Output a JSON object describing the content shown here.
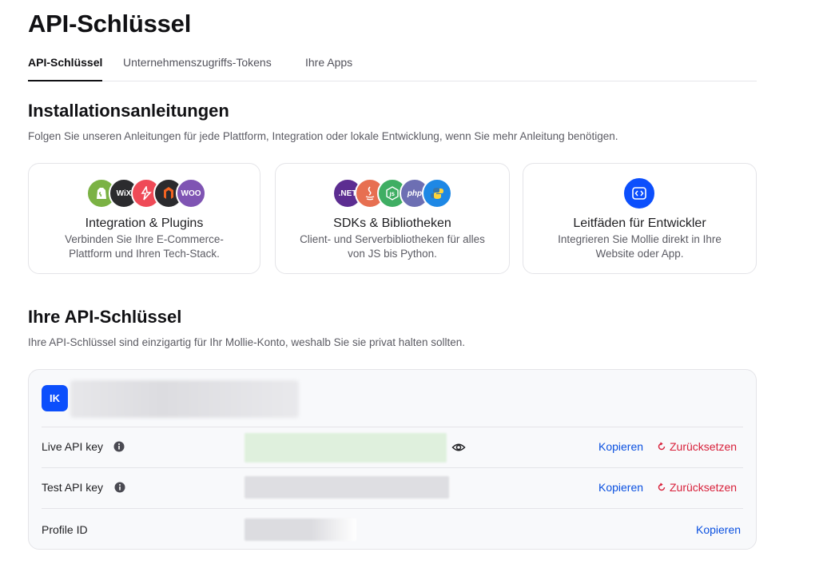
{
  "header": {
    "title": "API-Schlüssel"
  },
  "tabs": [
    {
      "label": "API-Schlüssel",
      "active": true
    },
    {
      "label": "Unternehmenszugriffs-Tokens",
      "active": false
    },
    {
      "label": "Ihre Apps",
      "active": false
    }
  ],
  "installation": {
    "title": "Installationsanleitungen",
    "description": "Folgen Sie unseren Anleitungen für jede Plattform, Integration oder lokale Entwicklung, wenn Sie mehr Anleitung benötigen.",
    "cards": [
      {
        "title": "Integration & Plugins",
        "description": "Verbinden Sie Ihre E-Commerce-Plattform und Ihren Tech-Stack.",
        "icons": [
          "shopify-icon",
          "wix-icon",
          "lightspeed-icon",
          "magento-icon",
          "woocommerce-icon"
        ]
      },
      {
        "title": "SDKs & Bibliotheken",
        "description": "Client- und Serverbibliotheken für alles von JS bis Python.",
        "icons": [
          "dotnet-icon",
          "java-icon",
          "nodejs-icon",
          "php-icon",
          "python-icon"
        ]
      },
      {
        "title": "Leitfäden für Entwickler",
        "description": "Integrieren Sie Mollie direkt in Ihre Website oder App.",
        "icons": [
          "code-guide-icon"
        ]
      }
    ]
  },
  "logo_text": {
    "wix": "WiX",
    "dotnet": ".NET",
    "php": "php",
    "woo": "WOO"
  },
  "api_keys": {
    "title": "Ihre API-Schlüssel",
    "description": "Ihre API-Schlüssel sind einzigartig für Ihr Mollie-Konto, weshalb Sie sie privat halten sollten.",
    "profile_initials": "IK",
    "rows": [
      {
        "label": "Live API key",
        "copy": "Kopieren",
        "reset": "Zurücksetzen"
      },
      {
        "label": "Test API key",
        "copy": "Kopieren",
        "reset": "Zurücksetzen"
      },
      {
        "label": "Profile ID",
        "copy": "Kopieren"
      }
    ]
  },
  "colors": {
    "accent": "#0a50e0",
    "danger": "#d8203a",
    "avatar": "#0c4ffc"
  }
}
